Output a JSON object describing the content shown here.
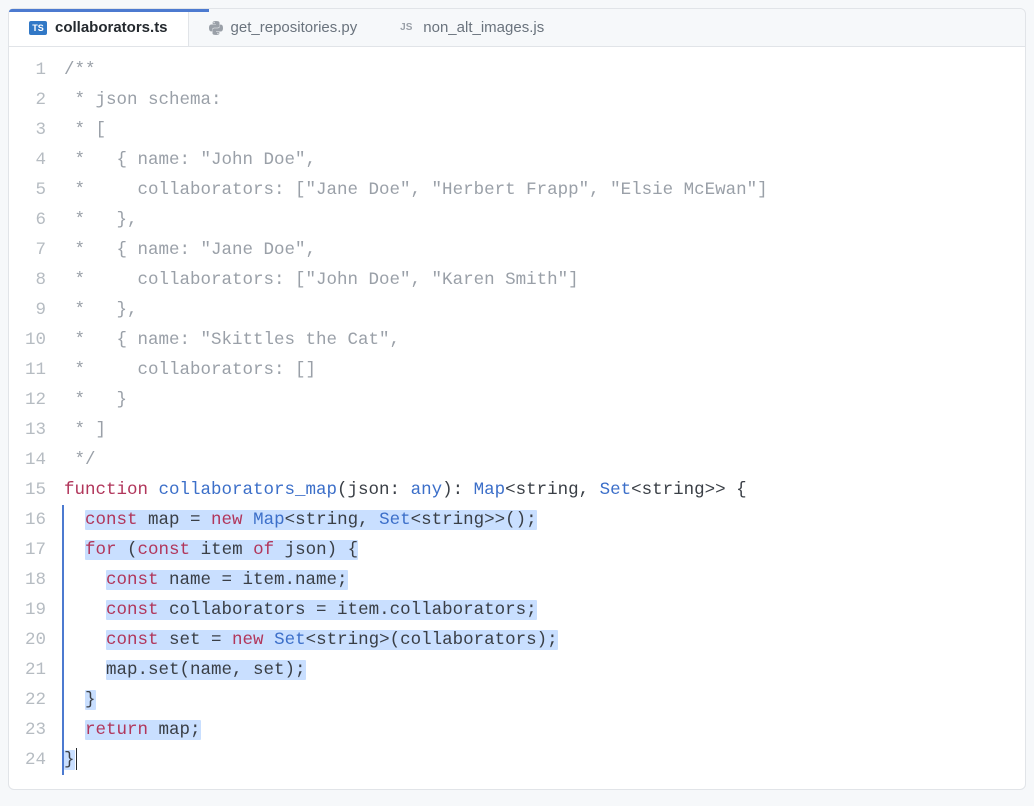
{
  "tabs": [
    {
      "label": "collaborators.ts",
      "icon": "TS",
      "iconClass": "ts",
      "active": true
    },
    {
      "label": "get_repositories.py",
      "icon": "ጫ",
      "iconClass": "py",
      "active": false
    },
    {
      "label": "non_alt_images.js",
      "icon": "JS",
      "iconClass": "js",
      "active": false
    }
  ],
  "code": {
    "line1": "/**",
    "line2": " * json schema:",
    "line3": " * [",
    "line4": " *   { name: \"John Doe\",",
    "line5": " *     collaborators: [\"Jane Doe\", \"Herbert Frapp\", \"Elsie McEwan\"]",
    "line6": " *   },",
    "line7": " *   { name: \"Jane Doe\",",
    "line8": " *     collaborators: [\"John Doe\", \"Karen Smith\"]",
    "line9": " *   },",
    "line10": " *   { name: \"Skittles the Cat\",",
    "line11": " *     collaborators: []",
    "line12": " *   }",
    "line13": " * ]",
    "line14": " */",
    "l15_function": "function",
    "l15_name": " collaborators_map",
    "l15_rest1": "(json: ",
    "l15_any": "any",
    "l15_rest2": "): ",
    "l15_map": "Map",
    "l15_rest3": "<string, ",
    "l15_set": "Set",
    "l15_rest4": "<string>> {",
    "l16_pad": "  ",
    "l16_const": "const",
    "l16_mid": " map = ",
    "l16_new": "new",
    "l16_sp": " ",
    "l16_map": "Map",
    "l16_rest1": "<string, ",
    "l16_set": "Set",
    "l16_rest2": "<string>>();",
    "l17_pad": "  ",
    "l17_for": "for",
    "l17_mid1": " (",
    "l17_const": "const",
    "l17_mid2": " item ",
    "l17_of": "of",
    "l17_rest": " json) {",
    "l18_pad": "    ",
    "l18_const": "const",
    "l18_rest": " name = item.name;",
    "l19_pad": "    ",
    "l19_const": "const",
    "l19_rest": " collaborators = item.collaborators;",
    "l20_pad": "    ",
    "l20_const": "const",
    "l20_mid": " set = ",
    "l20_new": "new",
    "l20_sp": " ",
    "l20_set": "Set",
    "l20_rest": "<string>(collaborators);",
    "l21_pad": "    ",
    "l21_rest": "map.set(name, set);",
    "l22_pad": "  ",
    "l22_rest": "}",
    "l23_pad": "  ",
    "l23_return": "return",
    "l23_rest": " map;",
    "l24_rest": "}"
  },
  "lineNumbers": [
    "1",
    "2",
    "3",
    "4",
    "5",
    "6",
    "7",
    "8",
    "9",
    "10",
    "11",
    "12",
    "13",
    "14",
    "15",
    "16",
    "17",
    "18",
    "19",
    "20",
    "21",
    "22",
    "23",
    "24"
  ]
}
